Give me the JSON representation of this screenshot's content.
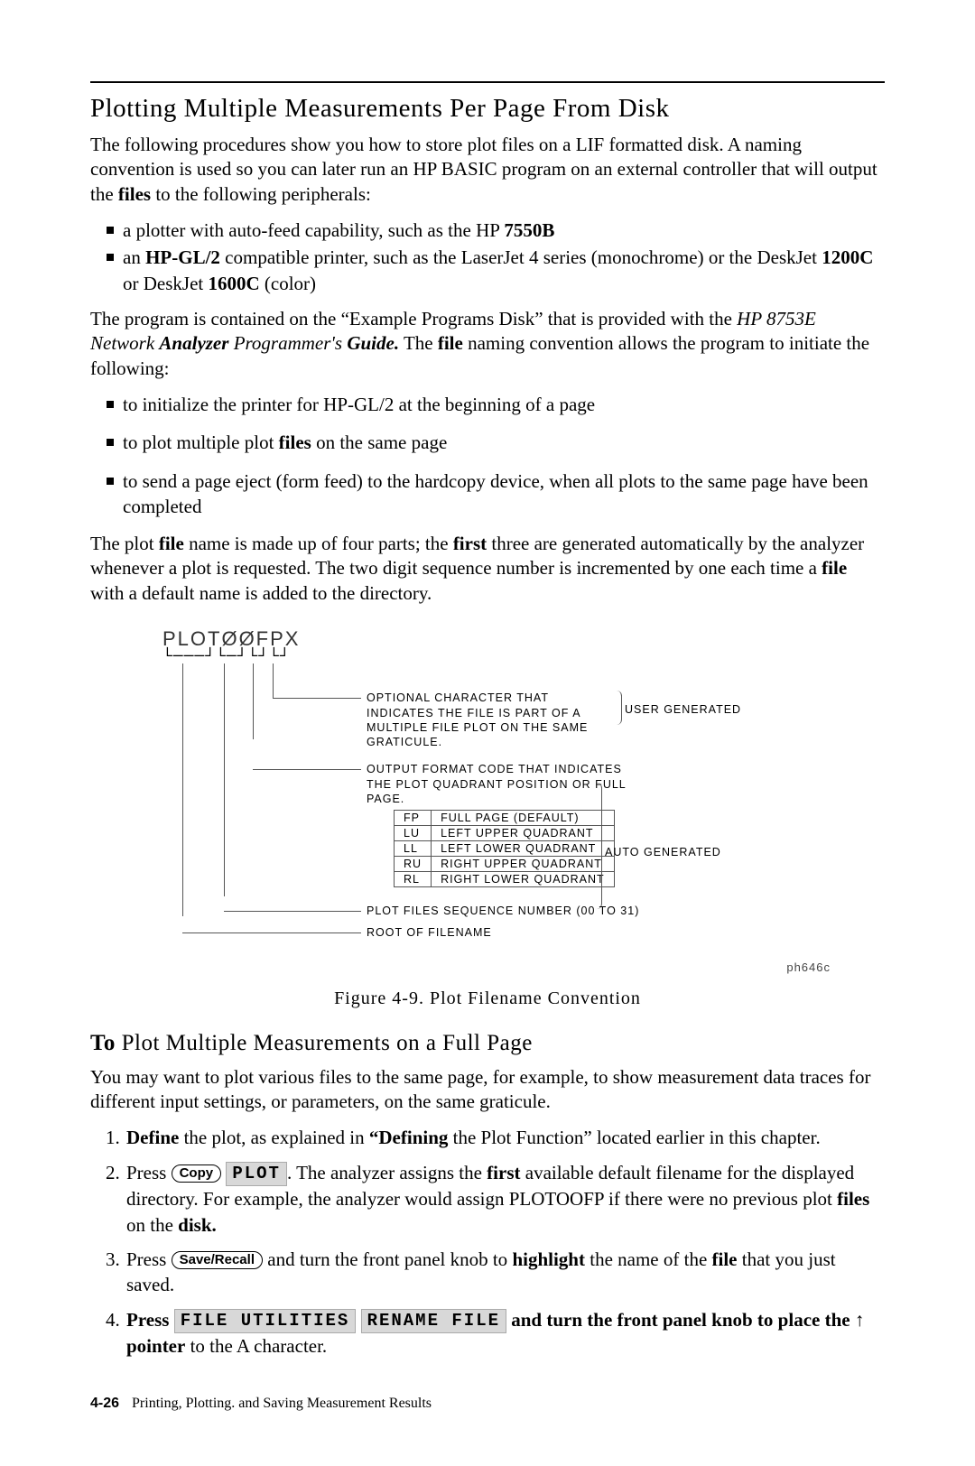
{
  "heading": "Plotting Multiple Measurements Per Page From Disk",
  "intro": {
    "p1_a": "The following procedures show you how to store plot files on a LIF formatted disk. A naming convention is used so you can later run an HP BASIC program on an external controller that will output the ",
    "p1_files": "files",
    "p1_b": " to the following peripherals:"
  },
  "periph_bullets": {
    "b1_a": "a plotter with auto-feed capability, such as the HP ",
    "b1_model": "7550B",
    "b2_a": "an ",
    "b2_hpgl": "HP-GL/2",
    "b2_b": " compatible printer, such as the LaserJet 4 series (monochrome) or the DeskJet ",
    "b2_m1": "1200C",
    "b2_c": " or DeskJet ",
    "b2_m2": "1600C",
    "b2_d": " (color)"
  },
  "prog_para": {
    "a": "The program is contained on the “Example Programs Disk” that is provided with the ",
    "ital1": "HP 8753E Network ",
    "bold_ital1": "Analyzer",
    "ital2": " Programmer's ",
    "bold_ital2": "Guide.",
    "b": " The ",
    "file": "file",
    "c": " naming convention allows the program to initiate the following:"
  },
  "init_bullets": {
    "b1": "to initialize the printer for HP-GL/2 at the beginning of a page",
    "b2_a": "to plot multiple plot ",
    "b2_files": "files",
    "b2_b": " on the same page",
    "b3": "to send a page eject (form feed) to the hardcopy device, when all plots to the same page have been completed"
  },
  "plotfile_para": {
    "a": "The plot ",
    "file": "file",
    "b": " name is made up of four parts; the ",
    "first": "first",
    "c": " three are generated automatically by the analyzer whenever a plot is requested. The two digit sequence number is incremented by one each time a ",
    "file2": "file",
    "d": " with a default name is added to the directory."
  },
  "figure": {
    "filename": "PLOTØØFPX",
    "brackets": "└───┘└─┘└┘└┘",
    "row1": "OPTIONAL CHARACTER THAT INDICATES THE FILE IS PART OF A MULTIPLE FILE PLOT ON THE SAME GRATICULE.",
    "row1_side": "USER GENERATED",
    "row2": "OUTPUT FORMAT CODE THAT INDICATES THE PLOT QUADRANT POSITION OR FULL PAGE.",
    "codes": [
      {
        "c": "FP",
        "d": "FULL PAGE (DEFAULT)"
      },
      {
        "c": "LU",
        "d": "LEFT UPPER QUADRANT"
      },
      {
        "c": "LL",
        "d": "LEFT LOWER QUADRANT"
      },
      {
        "c": "RU",
        "d": "RIGHT UPPER QUADRANT"
      },
      {
        "c": "RL",
        "d": "RIGHT LOWER QUADRANT"
      }
    ],
    "row2_side": "AUTO GENERATED",
    "row3": "PLOT FILES SEQUENCE NUMBER (00 TO 31)",
    "row4": "ROOT OF FILENAME",
    "figref": "ph646c",
    "caption": "Figure 4-9. Plot Filename Convention"
  },
  "subhead": {
    "to": "To",
    "rest": " Plot Multiple Measurements on a Full Page"
  },
  "sub_intro": "You may want to plot various files to the same page, for example, to show measurement data traces for different input settings, or parameters, on the same graticule.",
  "steps": {
    "s1_a": " the plot, as explained in ",
    "s1_define": "Define",
    "s1_quote": "“Defining",
    "s1_b": " the Plot Function” located earlier in this chapter.",
    "s2_press": "Press ",
    "s2_copy": "Copy",
    "s2_plot": "PLOT",
    "s2_a": ". The analyzer assigns the ",
    "s2_first": "first",
    "s2_b": " available default filename for the displayed directory. For example, the analyzer would assign PLOTOOFP if there were no previous plot ",
    "s2_files": "files",
    "s2_c": " on the ",
    "s2_disk": "disk.",
    "s3_press": "Press ",
    "s3_key": "Save/Recall",
    "s3_a": " and turn the front panel knob to ",
    "s3_hl": "highlight",
    "s3_b": " the name of the ",
    "s3_file": "file",
    "s3_c": " that you just saved.",
    "s4_press": "Press ",
    "s4_k1": "FILE UTILITIES",
    "s4_sp": "  ",
    "s4_k2": "RENAME FILE",
    "s4_a": " and turn the front panel knob to place the ↑ pointer",
    "s4_b": " to the A character."
  },
  "footer": {
    "pagenum": "4-26",
    "text": "Printing, Plotting. and Saving Measurement Results"
  }
}
